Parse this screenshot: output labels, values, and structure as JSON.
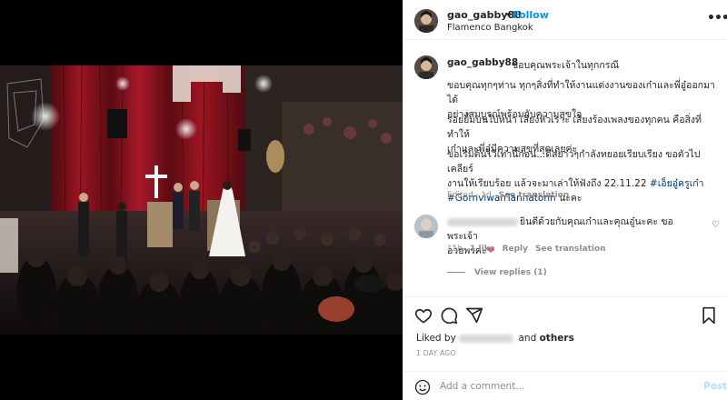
{
  "header": {
    "username": "gao_gabby88",
    "dot": "•",
    "follow_label": "Follow",
    "location": "Flamenco Bangkok",
    "more_icon": "more-horizontal-icon"
  },
  "caption": {
    "username": "gao_gabby88",
    "first_line": "ขอบคุณพระเจ้าในทุกกรณี",
    "p1_l1": "ขอบคุณทุกๆท่าน ทุกๆสิ่งที่ทำให้งานแต่งงานของเก๋าและพี่อู๋ออกมาได้",
    "p1_l2": "อย่างสมบูรณ์พร้อมกับความสุขใจ",
    "p2_l1": "รอยยิ้มบนใบหน้า เสียงหัวเราะ เสียงร้องเพลงของทุกคน คือสิ่งที่ทำให้",
    "p2_l2": "เก๋าและพี่อู๋มีความสุขที่สุดเลยค่ะ",
    "p3_l1": "ขอเริ่มต้นไว้เท่านี้ก่อน...ดีสยาวๆกำลังทยอยเรียบเรียง ขอตัวไปเคลียร์",
    "p3_l2_a": "งานให้เรียบร้อย แล้วจะมาเล่าให้ฟังถึง 22.11.22 ",
    "p3_l2_tag": "#เอ็ยอู๋ครูเก๋า",
    "p3_l3_tag": "#GornviwanTannatonn",
    "p3_l3_b": " นะคะ",
    "meta_time": "Edited · 1d",
    "meta_action": "See translation"
  },
  "comment": {
    "text_l1": "ยินดีด้วยกับคุณเก๋าและคุณอู๋นะคะ ขอพระเจ้า",
    "text_l2": "อวยพรคะ",
    "heart": "❤",
    "time": "15h",
    "likes": "1 like",
    "reply": "Reply",
    "translate": "See translation",
    "view_replies": "View replies (1)"
  },
  "actions": {
    "like_icon": "heart-icon",
    "comment_icon": "comment-icon",
    "share_icon": "share-icon",
    "save_icon": "bookmark-icon"
  },
  "likes": {
    "prefix": "Liked by ",
    "and": " and ",
    "others": "others"
  },
  "timestamp": "1 DAY AGO",
  "add_comment": {
    "placeholder": "Add a comment...",
    "post_label": "Post"
  },
  "colors": {
    "link": "#00376b",
    "follow": "#0095f6",
    "secondary": "#8e8e8e",
    "post_disabled": "#b2dffc"
  }
}
